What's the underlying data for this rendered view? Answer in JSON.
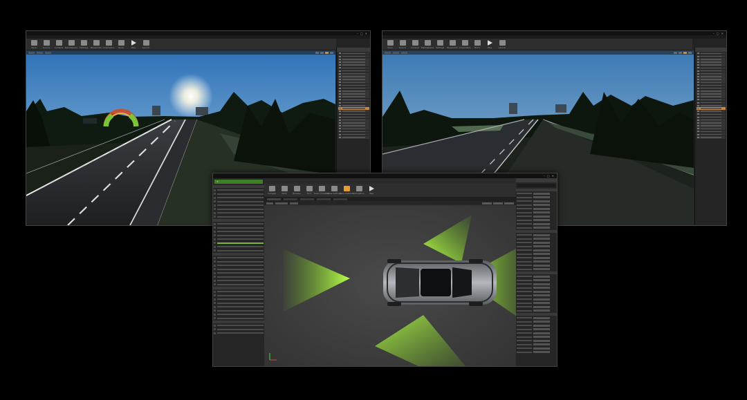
{
  "windows": [
    {
      "id": "left",
      "toolbar": {
        "tools": [
          "Save",
          "Source",
          "Content",
          "Marketplace",
          "Settings",
          "Blueprints",
          "Cinematics",
          "Build",
          "Play",
          "Launch"
        ]
      },
      "outliner": {
        "rows": 30,
        "selected_row": 19
      }
    },
    {
      "id": "right",
      "toolbar": {
        "tools": [
          "Save",
          "Source",
          "Content",
          "Marketplace",
          "Settings",
          "Blueprints",
          "Cinematics",
          "Build",
          "Play",
          "Launch"
        ]
      },
      "outliner": {
        "rows": 30,
        "selected_row": 19
      }
    },
    {
      "id": "center",
      "toolbar": {
        "tools": [
          "Compile",
          "Save",
          "Browse",
          "Find",
          "Hide Unrelated",
          "Class Settings",
          "Class Defaults",
          "Simulation",
          "Play"
        ],
        "active_tool": "Class Defaults"
      },
      "left_panel": {
        "rows": 40
      },
      "details_rows": 44
    }
  ],
  "colors": {
    "accent_orange": "#e89b2f",
    "sensor_green": "#8ddc30",
    "selected_row": "#c9873a",
    "add_component": "#3f7f28"
  }
}
